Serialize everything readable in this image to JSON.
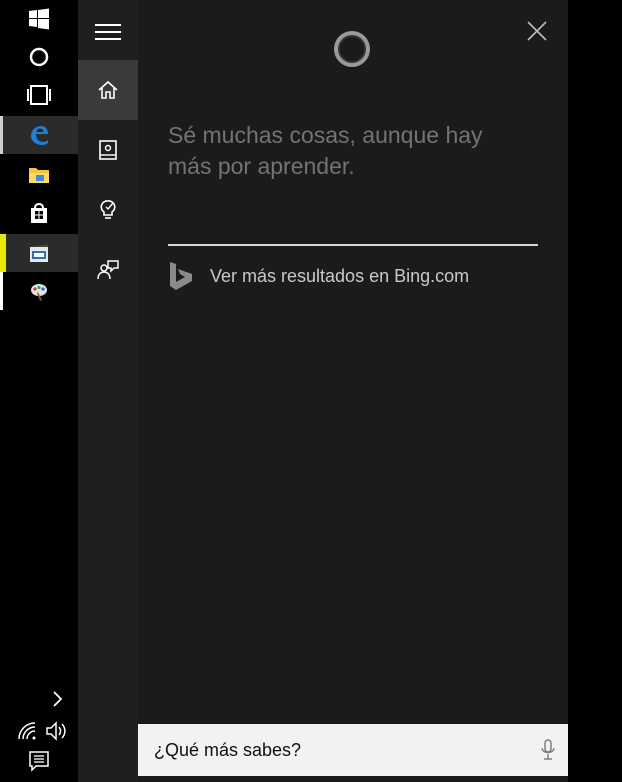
{
  "taskbar": {
    "items": [
      {
        "name": "windows-icon"
      },
      {
        "name": "cortana-search-icon"
      },
      {
        "name": "task-view-icon"
      },
      {
        "name": "edge-icon"
      },
      {
        "name": "file-explorer-icon"
      },
      {
        "name": "store-icon"
      },
      {
        "name": "video-editor-icon"
      },
      {
        "name": "paint-app-icon"
      }
    ],
    "tray": [
      "show-hidden-icons-chevron-icon",
      "wifi-icon",
      "volume-icon",
      "action-center-icon"
    ]
  },
  "rail": {
    "items": [
      {
        "name": "hamburger-menu-icon"
      },
      {
        "name": "home-icon",
        "selected": true
      },
      {
        "name": "notebook-icon"
      },
      {
        "name": "reminders-icon"
      },
      {
        "name": "feedback-icon"
      }
    ]
  },
  "panel": {
    "headline": "Sé muchas cosas, aunque hay más por aprender.",
    "bing_link": "Ver más resultados en Bing.com"
  },
  "search": {
    "value": "¿Qué más sabes?"
  },
  "colors": {
    "panel_bg": "#1b1b1b",
    "rail_bg": "#1f1f1f",
    "headline": "#737373",
    "search_bg": "#f2f2f2",
    "edge_blue": "#1f7fd6",
    "taskbar_yellow": "#e8e800"
  }
}
